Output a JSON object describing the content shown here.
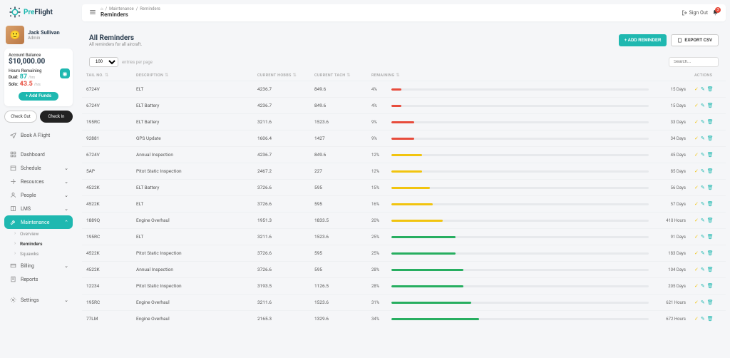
{
  "brand": {
    "pre": "Pre",
    "flight": "Flight"
  },
  "breadcrumb": {
    "home_icon": "home-icon",
    "seg1": "Maintenance",
    "seg2": "Reminders",
    "title": "Reminders"
  },
  "signout": {
    "label": "Sign Out"
  },
  "notifications": {
    "count": "3"
  },
  "user": {
    "name": "Jack Sullivan",
    "role": "Admin"
  },
  "balance": {
    "label": "Account Balance",
    "amount": "$10,000.00",
    "hours_label": "Hours Remaining",
    "dual_label": "Dual:",
    "dual_value": "87",
    "dual_unit": "/hrs",
    "solo_label": "Solo:",
    "solo_value": "43.5",
    "solo_unit": "/hrs",
    "add_funds": "+ Add Funds"
  },
  "check": {
    "out": "Check Out",
    "in": "Check In"
  },
  "nav": {
    "book": "Book A Flight",
    "dashboard": "Dashboard",
    "schedule": "Schedule",
    "resources": "Resources",
    "people": "People",
    "lms": "LMS",
    "maintenance": "Maintenance",
    "sub": {
      "overview": "Overview",
      "reminders": "Reminders",
      "squawks": "Squawks"
    },
    "billing": "Billing",
    "reports": "Reports",
    "settings": "Settings"
  },
  "page": {
    "title": "All Reminders",
    "subtitle": "All reminders for all aircraft.",
    "add_btn": "+ ADD REMINDER",
    "export_btn": "EXPORT CSV",
    "page_size": "100",
    "entries_label": "entries per page",
    "search_placeholder": "Search..."
  },
  "columns": {
    "tail": "TAIL NO.",
    "desc": "DESCRIPTION",
    "hobbs": "CURRENT HOBBS",
    "tach": "CURRENT TACH",
    "remaining": "REMAINING",
    "actions": "ACTIONS"
  },
  "rows": [
    {
      "tail": "6724V",
      "desc": "ELT",
      "hobbs": "4236.7",
      "tach": "849.6",
      "pct": "4%",
      "bar": 4,
      "color": "red",
      "val": "15 Days"
    },
    {
      "tail": "6724V",
      "desc": "ELT Battery",
      "hobbs": "4236.7",
      "tach": "849.6",
      "pct": "4%",
      "bar": 4,
      "color": "red",
      "val": "15 Days"
    },
    {
      "tail": "195RC",
      "desc": "ELT Battery",
      "hobbs": "3211.6",
      "tach": "1523.6",
      "pct": "9%",
      "bar": 9,
      "color": "red",
      "val": "33 Days"
    },
    {
      "tail": "92881",
      "desc": "GPS Update",
      "hobbs": "1606.4",
      "tach": "1427",
      "pct": "9%",
      "bar": 9,
      "color": "red",
      "val": "34 Days"
    },
    {
      "tail": "6724V",
      "desc": "Annual Inspection",
      "hobbs": "4236.7",
      "tach": "849.6",
      "pct": "12%",
      "bar": 12,
      "color": "yellow",
      "val": "45 Days"
    },
    {
      "tail": "5AP",
      "desc": "Pitot Static Inspection",
      "hobbs": "2467.2",
      "tach": "227",
      "pct": "12%",
      "bar": 12,
      "color": "yellow",
      "val": "85 Days"
    },
    {
      "tail": "4522K",
      "desc": "ELT Battery",
      "hobbs": "3726.6",
      "tach": "595",
      "pct": "15%",
      "bar": 15,
      "color": "yellow",
      "val": "56 Days"
    },
    {
      "tail": "4522K",
      "desc": "ELT",
      "hobbs": "3726.6",
      "tach": "595",
      "pct": "16%",
      "bar": 16,
      "color": "yellow",
      "val": "57 Days"
    },
    {
      "tail": "1889Q",
      "desc": "Engine Overhaul",
      "hobbs": "1951.3",
      "tach": "1833.5",
      "pct": "20%",
      "bar": 20,
      "color": "yellow",
      "val": "410 Hours"
    },
    {
      "tail": "195RC",
      "desc": "ELT",
      "hobbs": "3211.6",
      "tach": "1523.6",
      "pct": "25%",
      "bar": 25,
      "color": "green",
      "val": "91 Days"
    },
    {
      "tail": "4522K",
      "desc": "Pitot Static Inspection",
      "hobbs": "3726.6",
      "tach": "595",
      "pct": "25%",
      "bar": 25,
      "color": "green",
      "val": "183 Days"
    },
    {
      "tail": "4522K",
      "desc": "Annual Inspection",
      "hobbs": "3726.6",
      "tach": "595",
      "pct": "28%",
      "bar": 28,
      "color": "green",
      "val": "104 Days"
    },
    {
      "tail": "12234",
      "desc": "Pitot Static Inspection",
      "hobbs": "3193.5",
      "tach": "1126.5",
      "pct": "28%",
      "bar": 28,
      "color": "green",
      "val": "205 Days"
    },
    {
      "tail": "195RC",
      "desc": "Engine Overhaul",
      "hobbs": "3211.6",
      "tach": "1523.6",
      "pct": "31%",
      "bar": 31,
      "color": "green",
      "val": "621 Hours"
    },
    {
      "tail": "77LM",
      "desc": "Engine Overhaul",
      "hobbs": "2165.3",
      "tach": "1329.6",
      "pct": "34%",
      "bar": 34,
      "color": "green",
      "val": "672 Hours"
    }
  ]
}
